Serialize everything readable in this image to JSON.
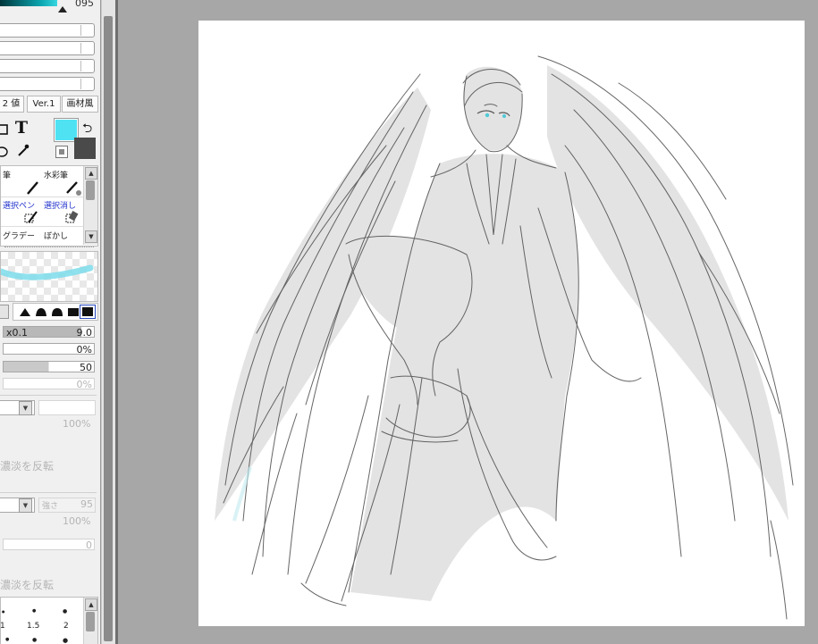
{
  "color": {
    "hue_value": "095",
    "foreground": "#4fe2f3",
    "background": "#4a4a4a"
  },
  "modes": [
    "2 値",
    "Ver.1",
    "画材風"
  ],
  "tools_icons": [
    "bucket-icon",
    "text-tool-icon",
    "eyedropper-icon",
    "lasso-icon"
  ],
  "tool_palette": {
    "row1": [
      "筆",
      "水彩筆"
    ],
    "row2": [
      "選択ペン",
      "選択消し"
    ],
    "row3": [
      "グラデー",
      "ぼかし"
    ]
  },
  "brush": {
    "size_multiplier": "x0.1",
    "size": "9.0",
    "min_size": "0%",
    "density": "50",
    "blending": "0%",
    "percent_a": "100%",
    "invert_a": "濃淡を反転",
    "strength_label": "強さ",
    "strength": "95",
    "percent_b": "100%",
    "value_c": "0",
    "invert_b": "濃淡を反転"
  },
  "size_presets": [
    "1",
    "1.5",
    "2"
  ]
}
